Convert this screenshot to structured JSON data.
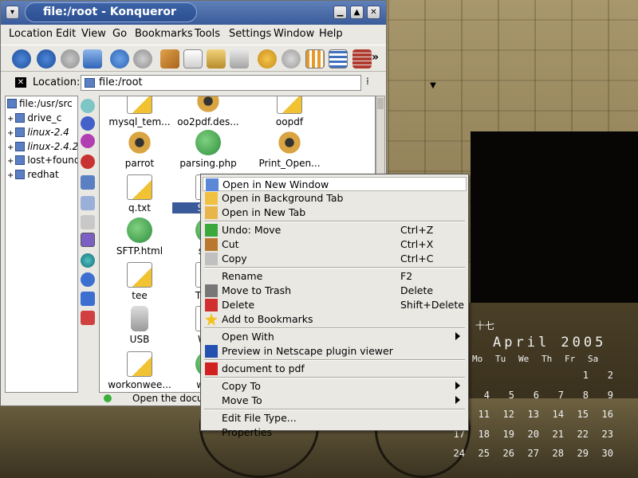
{
  "window": {
    "title": "file:/root - Konqueror"
  },
  "menubar": [
    "Location",
    "Edit",
    "View",
    "Go",
    "Bookmarks",
    "Tools",
    "Settings",
    "Window",
    "Help"
  ],
  "location": {
    "label": "Location:",
    "value": "file:/root"
  },
  "tree": [
    {
      "label": "file:/usr/src"
    },
    {
      "label": "drive_c"
    },
    {
      "label": "linux-2.4"
    },
    {
      "label": "linux-2.4.2"
    },
    {
      "label": "lost+found"
    },
    {
      "label": "redhat"
    }
  ],
  "files": [
    {
      "label": "mysql_tem...",
      "type": "doc"
    },
    {
      "label": "oo2pdf.des...",
      "type": "gear"
    },
    {
      "label": "oopdf",
      "type": "doc"
    },
    {
      "label": "parrot",
      "type": "gear"
    },
    {
      "label": "parsing.php",
      "type": "web"
    },
    {
      "label": "Print_Open...",
      "type": "gear"
    },
    {
      "label": "q.txt",
      "type": "doc"
    },
    {
      "label": "Sam",
      "type": "doc"
    },
    {
      "label": "SFTP.html",
      "type": "web"
    },
    {
      "label": "sip1",
      "type": "web"
    },
    {
      "label": "tee",
      "type": "doc"
    },
    {
      "label": "TRAN",
      "type": "doc"
    },
    {
      "label": "USB",
      "type": "usb"
    },
    {
      "label": "Wee",
      "type": "doc"
    },
    {
      "label": "workonwee...",
      "type": "doc"
    },
    {
      "label": "www",
      "type": "web"
    }
  ],
  "status": {
    "text": "Open the docu"
  },
  "context_menu": {
    "items": [
      {
        "label": "Open in New Window",
        "icon": "new-window-icon",
        "shortcut": ""
      },
      {
        "label": "Open in Background Tab",
        "icon": "background-tab-icon",
        "shortcut": ""
      },
      {
        "label": "Open in New Tab",
        "icon": "new-tab-icon",
        "shortcut": ""
      },
      {
        "sep": true
      },
      {
        "label": "Undo: Move",
        "icon": "undo-icon",
        "shortcut": "Ctrl+Z"
      },
      {
        "label": "Cut",
        "icon": "cut-icon",
        "shortcut": "Ctrl+X"
      },
      {
        "label": "Copy",
        "icon": "copy-icon",
        "shortcut": "Ctrl+C"
      },
      {
        "sep": true
      },
      {
        "label": "Rename",
        "icon": "",
        "shortcut": "F2"
      },
      {
        "label": "Move to Trash",
        "icon": "trash-icon",
        "shortcut": "Delete"
      },
      {
        "label": "Delete",
        "icon": "delete-icon",
        "shortcut": "Shift+Delete"
      },
      {
        "label": "Add to Bookmarks",
        "icon": "bookmark-star-icon",
        "shortcut": ""
      },
      {
        "sep": true
      },
      {
        "label": "Open With",
        "icon": "",
        "shortcut": "",
        "submenu": true
      },
      {
        "label": "Preview in Netscape plugin viewer",
        "icon": "netscape-icon",
        "shortcut": ""
      },
      {
        "sep": true
      },
      {
        "label": "document to pdf",
        "icon": "pdf-icon",
        "shortcut": ""
      },
      {
        "sep": true
      },
      {
        "label": "Copy To",
        "icon": "",
        "shortcut": "",
        "submenu": true
      },
      {
        "label": "Move To",
        "icon": "",
        "shortcut": "",
        "submenu": true
      },
      {
        "sep": true
      },
      {
        "label": "Edit File Type...",
        "icon": "",
        "shortcut": ""
      },
      {
        "label": "Properties",
        "icon": "",
        "shortcut": ""
      }
    ]
  },
  "calendar": {
    "top_label": "十七",
    "title": "April 2005",
    "weekdays": [
      "Mo",
      "Tu",
      "We",
      "Th",
      "Fr",
      "Sa"
    ],
    "weeks": [
      [
        "",
        "",
        "",
        "",
        "",
        "1",
        "2"
      ],
      [
        "3",
        "4",
        "5",
        "6",
        "7",
        "8",
        "9"
      ],
      [
        "10",
        "11",
        "12",
        "13",
        "14",
        "15",
        "16"
      ],
      [
        "17",
        "18",
        "19",
        "20",
        "21",
        "22",
        "23"
      ],
      [
        "24",
        "25",
        "26",
        "27",
        "28",
        "29",
        "30"
      ]
    ]
  }
}
